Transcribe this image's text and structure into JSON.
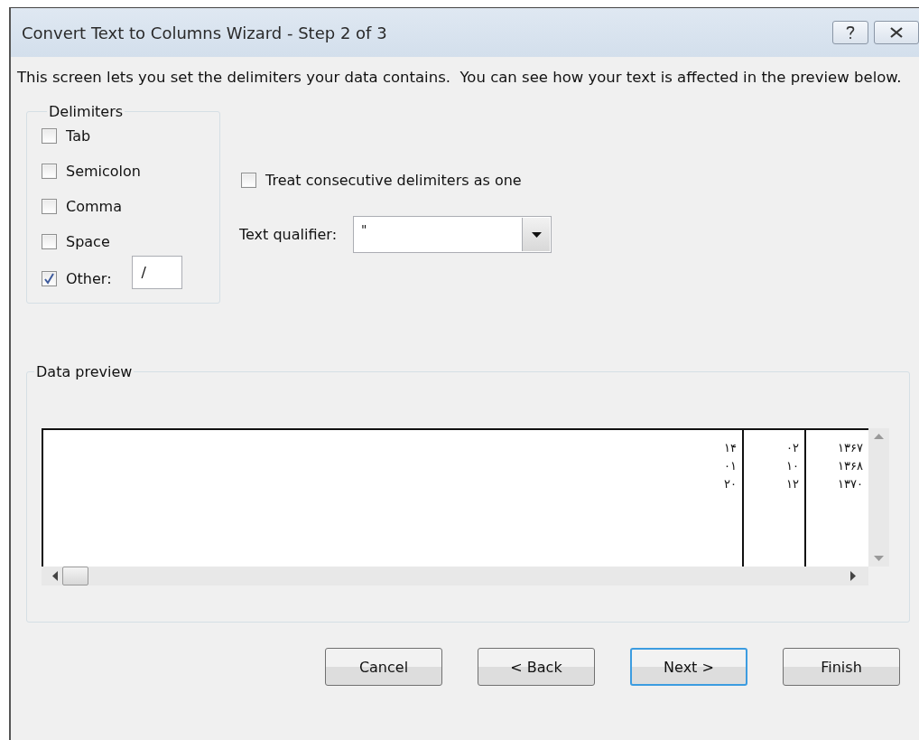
{
  "window": {
    "title": "Convert Text to Columns Wizard - Step 2 of 3"
  },
  "intro": "This screen lets you set the delimiters your data contains.  You can see how your text is affected in the preview below.",
  "delimiters": {
    "legend": "Delimiters",
    "options": [
      {
        "label": "Tab",
        "checked": false
      },
      {
        "label": "Semicolon",
        "checked": false
      },
      {
        "label": "Comma",
        "checked": false
      },
      {
        "label": "Space",
        "checked": false
      },
      {
        "label": "Other:",
        "checked": true,
        "value": "/"
      }
    ]
  },
  "consecutive": {
    "label": "Treat consecutive delimiters as one",
    "checked": false
  },
  "text_qualifier": {
    "label": "Text qualifier:",
    "value": "\""
  },
  "data_preview": {
    "legend": "Data preview",
    "rows": [
      [
        "۱۴",
        "۰۲",
        "۱۳۶۷"
      ],
      [
        "۰۱",
        "۱۰",
        "۱۳۶۸"
      ],
      [
        "۲۰",
        "۱۲",
        "۱۳۷۰"
      ]
    ]
  },
  "buttons": [
    {
      "label": "Cancel",
      "default": false
    },
    {
      "label": "< Back",
      "default": false
    },
    {
      "label": "Next >",
      "default": true
    },
    {
      "label": "Finish",
      "default": false
    }
  ]
}
